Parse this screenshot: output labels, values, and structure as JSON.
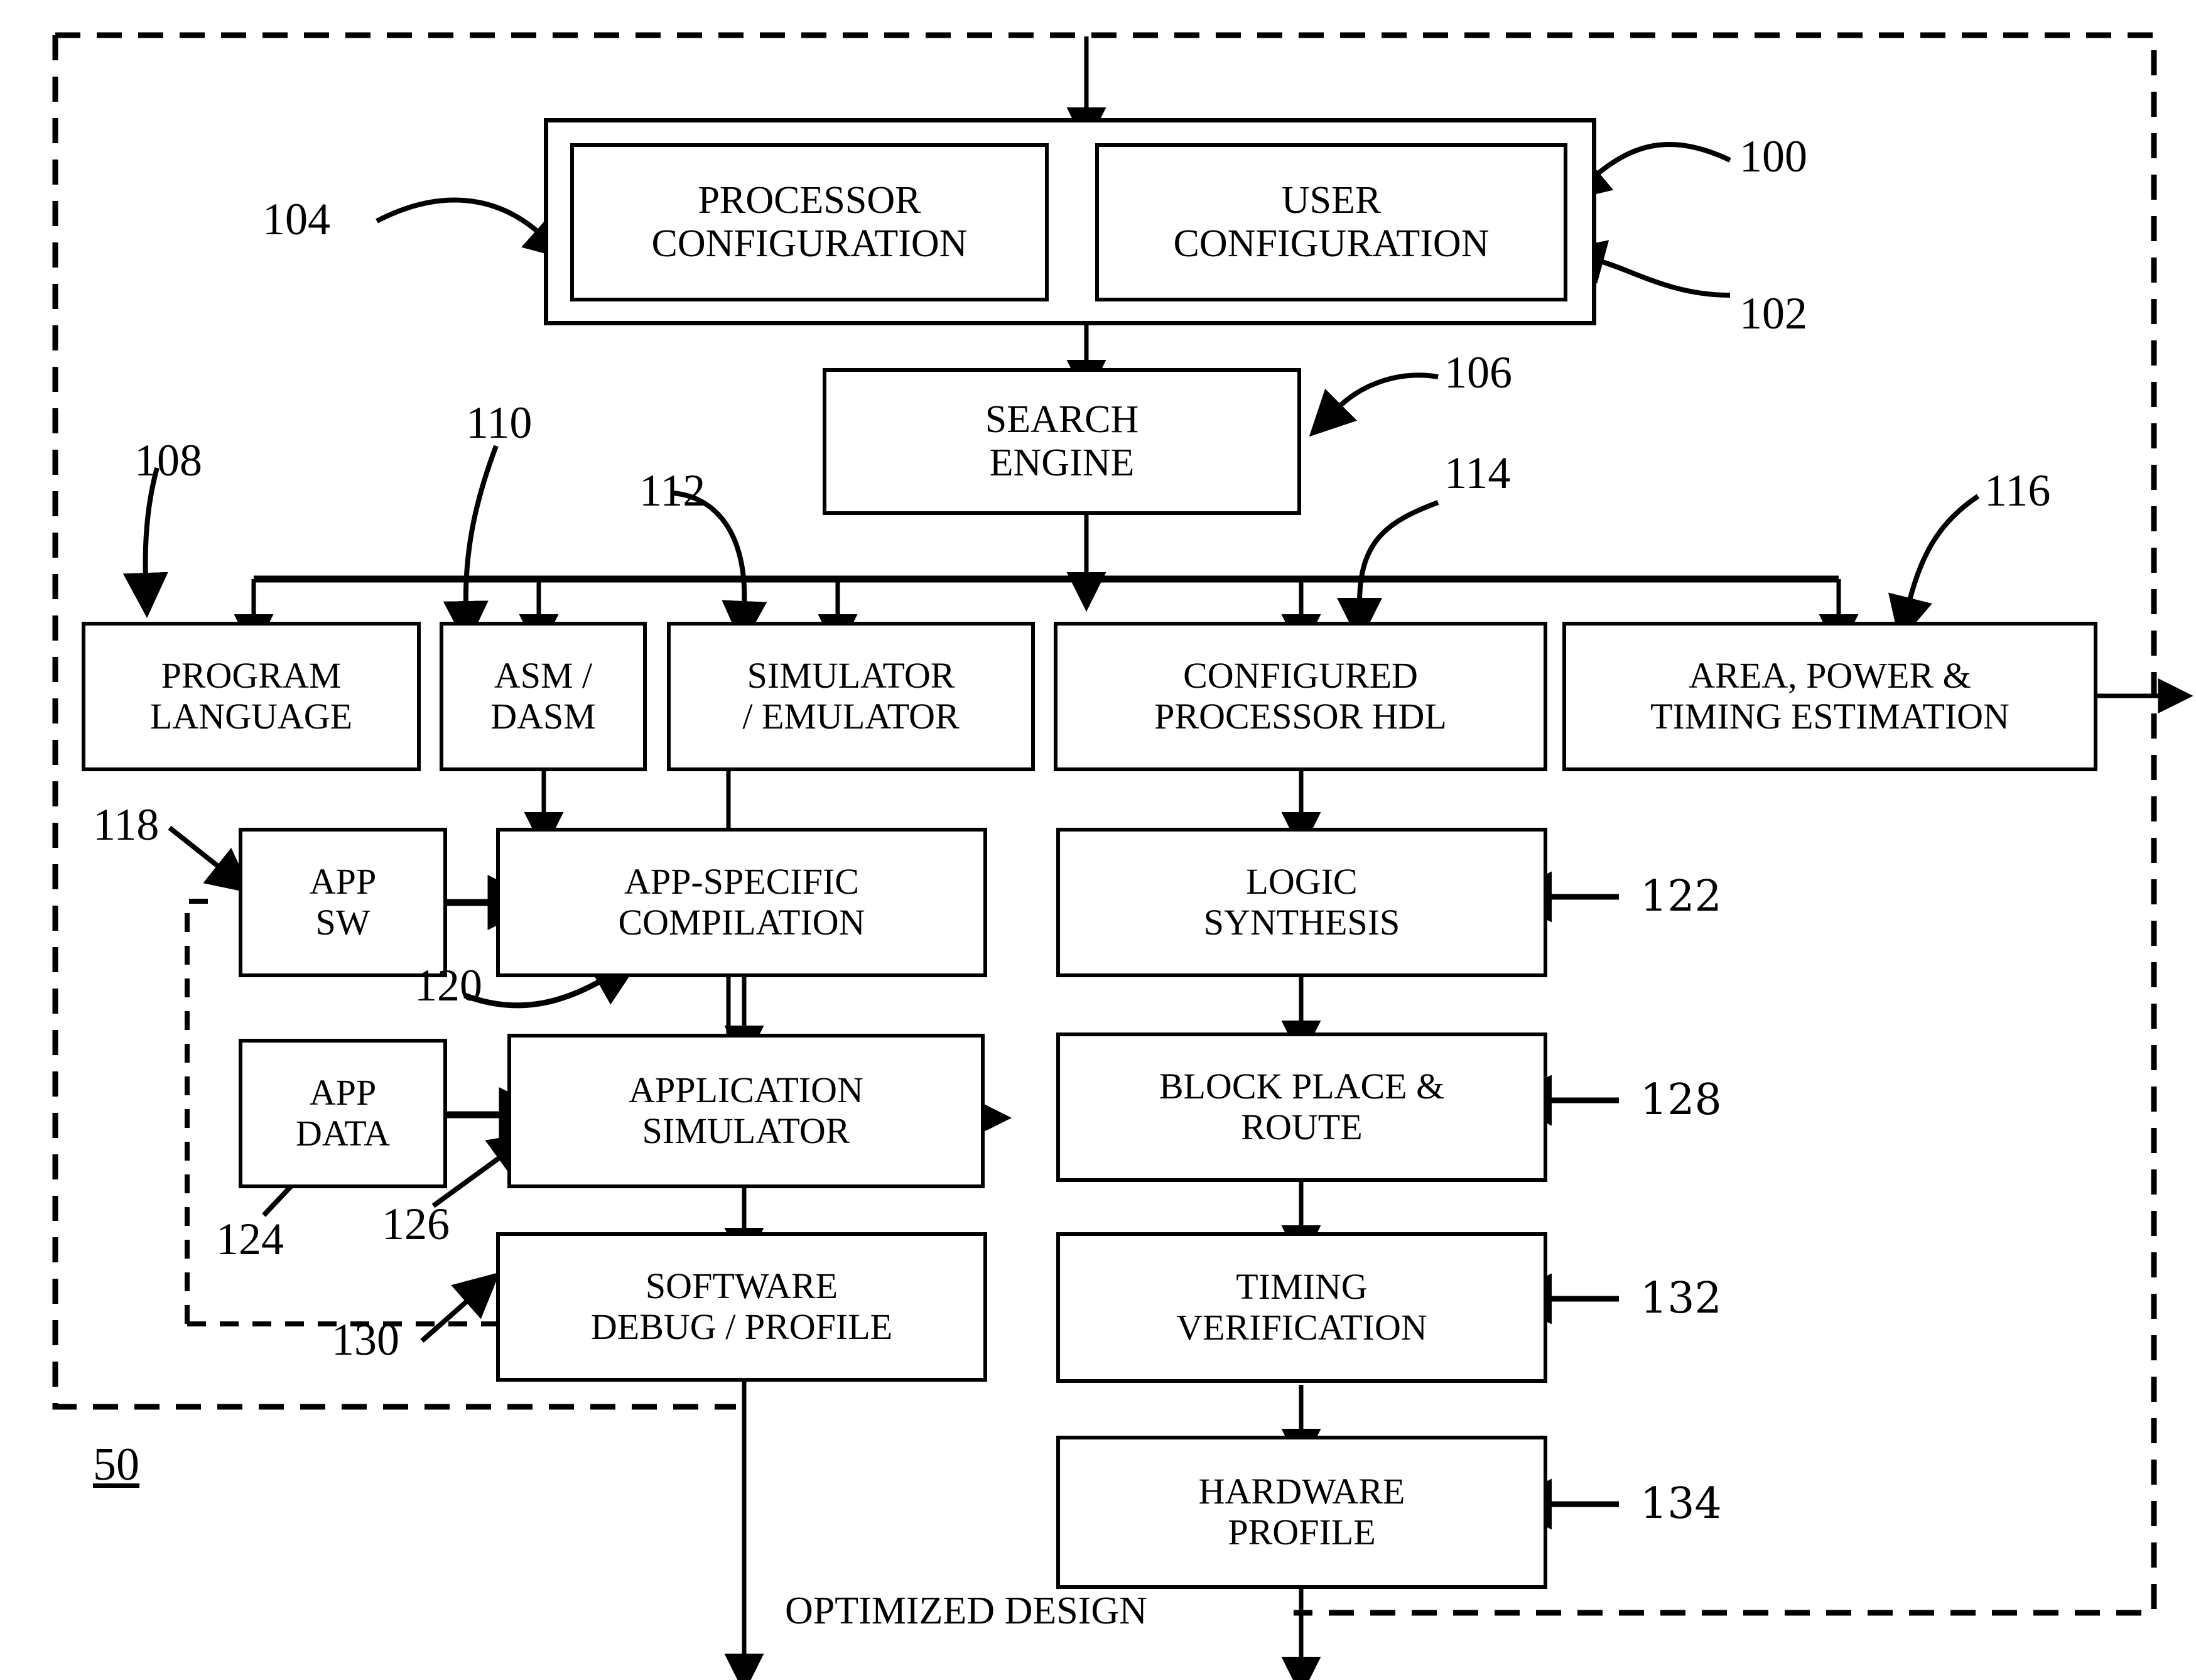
{
  "figure": {
    "system_label": "50",
    "optimized_design_label": "OPTIMIZED DESIGN"
  },
  "boxes": {
    "processor_configuration": {
      "line1": "PROCESSOR",
      "line2": "CONFIGURATION"
    },
    "user_configuration": {
      "line1": "USER",
      "line2": "CONFIGURATION"
    },
    "search_engine": {
      "line1": "SEARCH",
      "line2": "ENGINE"
    },
    "program_language": {
      "line1": "PROGRAM",
      "line2": "LANGUAGE"
    },
    "asm_dasm": {
      "line1": "ASM /",
      "line2": "DASM"
    },
    "simulator_emulator": {
      "line1": "SIMULATOR",
      "line2": "/ EMULATOR"
    },
    "configured_processor_hdl": {
      "line1": "CONFIGURED",
      "line2": "PROCESSOR HDL"
    },
    "area_power_timing": {
      "line1": "AREA, POWER &",
      "line2": "TIMING ESTIMATION"
    },
    "app_sw": {
      "line1": "APP",
      "line2": "SW"
    },
    "app_specific_compilation": {
      "line1": "APP-SPECIFIC",
      "line2": "COMPILATION"
    },
    "app_data": {
      "line1": "APP",
      "line2": "DATA"
    },
    "application_simulator": {
      "line1": "APPLICATION",
      "line2": "SIMULATOR"
    },
    "software_debug_profile": {
      "line1": "SOFTWARE",
      "line2": "DEBUG / PROFILE"
    },
    "logic_synthesis": {
      "line1": "LOGIC",
      "line2": "SYNTHESIS"
    },
    "block_place_route": {
      "line1": "BLOCK PLACE &",
      "line2": "ROUTE"
    },
    "timing_verification": {
      "line1": "TIMING",
      "line2": "VERIFICATION"
    },
    "hardware_profile": {
      "line1": "HARDWARE",
      "line2": "PROFILE"
    }
  },
  "reference_numerals": {
    "n100": "100",
    "n102": "102",
    "n104": "104",
    "n106": "106",
    "n108": "108",
    "n110": "110",
    "n112": "112",
    "n114": "114",
    "n116": "116",
    "n118": "118",
    "n120": "120",
    "n122": "122",
    "n124": "124",
    "n126": "126",
    "n128": "128",
    "n130": "130",
    "n132": "132",
    "n134": "134"
  }
}
